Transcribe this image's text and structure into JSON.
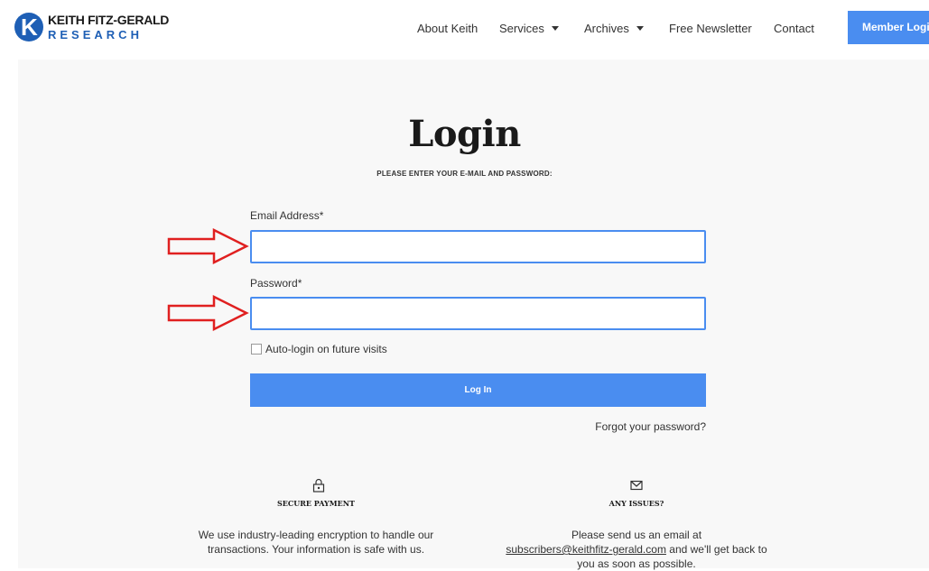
{
  "logo": {
    "line1": "KEITH FITZ-GERALD",
    "line2": "RESEARCH"
  },
  "nav": {
    "about": "About Keith",
    "services": "Services",
    "archives": "Archives",
    "newsletter": "Free Newsletter",
    "contact": "Contact",
    "member_login": "Member Login"
  },
  "login": {
    "title": "Login",
    "subtitle": "PLEASE ENTER YOUR E-MAIL AND PASSWORD:",
    "email_label": "Email Address",
    "password_label": "Password",
    "required_marker": "*",
    "email_value": "",
    "password_value": "",
    "auto_login_label": "Auto-login on future visits",
    "auto_login_checked": false,
    "button": "Log In",
    "forgot": "Forgot your password?"
  },
  "info": {
    "secure": {
      "icon": "lock-icon",
      "title": "SECURE PAYMENT",
      "line1": "We use industry-leading encryption to handle our",
      "line2": "transactions. Your information is safe with us."
    },
    "issues": {
      "icon": "mail-icon",
      "title": "ANY ISSUES?",
      "line1": "Please send us an email at",
      "email": "subscribers@keithfitz-gerald.com",
      "line2_tail": " and we'll get back to",
      "line3": "you as soon as possible."
    }
  },
  "colors": {
    "accent": "#4a8df0",
    "brand": "#1e5fb5",
    "annotation_arrow": "#e02020"
  }
}
